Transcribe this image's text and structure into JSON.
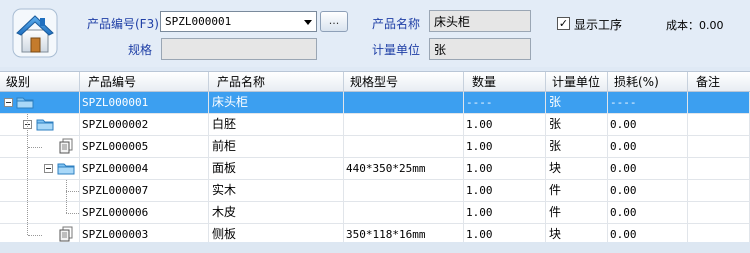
{
  "form": {
    "product_code_label": "产品编号(F3)",
    "product_code_value": "SPZL000001",
    "browse_label": "...",
    "product_name_label": "产品名称",
    "product_name_value": "床头柜",
    "show_process_label": "显示工序",
    "show_process_checked": true,
    "cost_label": "成本：0.00",
    "spec_label": "规格",
    "spec_value": "",
    "unit_label": "计量单位",
    "unit_value": "张"
  },
  "table": {
    "headers": [
      "级别",
      "产品编号",
      "产品名称",
      "规格型号",
      "数量",
      "计量单位",
      "损耗(%)",
      "备注"
    ],
    "rows": [
      {
        "level": 0,
        "node": "root",
        "code": "SPZL000001",
        "name": "床头柜",
        "spec": "",
        "qty": "----",
        "unit": "张",
        "loss": "----",
        "note": "",
        "selected": true
      },
      {
        "level": 1,
        "node": "folder",
        "code": "SPZL000002",
        "name": "白胚",
        "spec": "",
        "qty": "1.00",
        "unit": "张",
        "loss": "0.00",
        "note": ""
      },
      {
        "level": 2,
        "node": "doc",
        "code": "SPZL000005",
        "name": "前柜",
        "spec": "",
        "qty": "1.00",
        "unit": "张",
        "loss": "0.00",
        "note": ""
      },
      {
        "level": 2,
        "node": "folder",
        "code": "SPZL000004",
        "name": "面板",
        "spec": "440*350*25mm",
        "qty": "1.00",
        "unit": "块",
        "loss": "0.00",
        "note": ""
      },
      {
        "level": 3,
        "node": "leaf",
        "code": "SPZL000007",
        "name": "实木",
        "spec": "",
        "qty": "1.00",
        "unit": "件",
        "loss": "0.00",
        "note": ""
      },
      {
        "level": 3,
        "node": "leaf",
        "code": "SPZL000006",
        "name": "木皮",
        "spec": "",
        "qty": "1.00",
        "unit": "件",
        "loss": "0.00",
        "note": ""
      },
      {
        "level": 2,
        "node": "doc",
        "code": "SPZL000003",
        "name": "侧板",
        "spec": "350*118*16mm",
        "qty": "1.00",
        "unit": "块",
        "loss": "0.00",
        "note": ""
      }
    ]
  },
  "colors": {
    "accent": "#3c9ff0",
    "label": "#1f3fa6"
  }
}
